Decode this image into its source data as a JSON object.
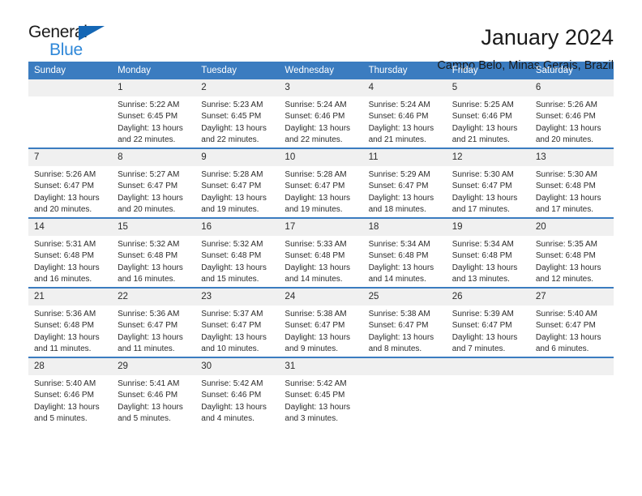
{
  "logo": {
    "word_one": "General",
    "word_two": "Blue",
    "triangle_color": "#1567b5",
    "blue_color": "#2e87d8"
  },
  "header": {
    "title": "January 2024",
    "subtitle": "Campo Belo, Minas Gerais, Brazil"
  },
  "theme": {
    "header_blue": "#3b7cc0",
    "daynum_band": "#f0f0f0",
    "text": "#2b2b2b"
  },
  "weekday_headers": [
    "Sunday",
    "Monday",
    "Tuesday",
    "Wednesday",
    "Thursday",
    "Friday",
    "Saturday"
  ],
  "weeks": [
    [
      {
        "day": "",
        "sunrise": "",
        "sunset": "",
        "daylight_line1": "",
        "daylight_line2": ""
      },
      {
        "day": "1",
        "sunrise": "Sunrise: 5:22 AM",
        "sunset": "Sunset: 6:45 PM",
        "daylight_line1": "Daylight: 13 hours",
        "daylight_line2": "and 22 minutes."
      },
      {
        "day": "2",
        "sunrise": "Sunrise: 5:23 AM",
        "sunset": "Sunset: 6:45 PM",
        "daylight_line1": "Daylight: 13 hours",
        "daylight_line2": "and 22 minutes."
      },
      {
        "day": "3",
        "sunrise": "Sunrise: 5:24 AM",
        "sunset": "Sunset: 6:46 PM",
        "daylight_line1": "Daylight: 13 hours",
        "daylight_line2": "and 22 minutes."
      },
      {
        "day": "4",
        "sunrise": "Sunrise: 5:24 AM",
        "sunset": "Sunset: 6:46 PM",
        "daylight_line1": "Daylight: 13 hours",
        "daylight_line2": "and 21 minutes."
      },
      {
        "day": "5",
        "sunrise": "Sunrise: 5:25 AM",
        "sunset": "Sunset: 6:46 PM",
        "daylight_line1": "Daylight: 13 hours",
        "daylight_line2": "and 21 minutes."
      },
      {
        "day": "6",
        "sunrise": "Sunrise: 5:26 AM",
        "sunset": "Sunset: 6:46 PM",
        "daylight_line1": "Daylight: 13 hours",
        "daylight_line2": "and 20 minutes."
      }
    ],
    [
      {
        "day": "7",
        "sunrise": "Sunrise: 5:26 AM",
        "sunset": "Sunset: 6:47 PM",
        "daylight_line1": "Daylight: 13 hours",
        "daylight_line2": "and 20 minutes."
      },
      {
        "day": "8",
        "sunrise": "Sunrise: 5:27 AM",
        "sunset": "Sunset: 6:47 PM",
        "daylight_line1": "Daylight: 13 hours",
        "daylight_line2": "and 20 minutes."
      },
      {
        "day": "9",
        "sunrise": "Sunrise: 5:28 AM",
        "sunset": "Sunset: 6:47 PM",
        "daylight_line1": "Daylight: 13 hours",
        "daylight_line2": "and 19 minutes."
      },
      {
        "day": "10",
        "sunrise": "Sunrise: 5:28 AM",
        "sunset": "Sunset: 6:47 PM",
        "daylight_line1": "Daylight: 13 hours",
        "daylight_line2": "and 19 minutes."
      },
      {
        "day": "11",
        "sunrise": "Sunrise: 5:29 AM",
        "sunset": "Sunset: 6:47 PM",
        "daylight_line1": "Daylight: 13 hours",
        "daylight_line2": "and 18 minutes."
      },
      {
        "day": "12",
        "sunrise": "Sunrise: 5:30 AM",
        "sunset": "Sunset: 6:47 PM",
        "daylight_line1": "Daylight: 13 hours",
        "daylight_line2": "and 17 minutes."
      },
      {
        "day": "13",
        "sunrise": "Sunrise: 5:30 AM",
        "sunset": "Sunset: 6:48 PM",
        "daylight_line1": "Daylight: 13 hours",
        "daylight_line2": "and 17 minutes."
      }
    ],
    [
      {
        "day": "14",
        "sunrise": "Sunrise: 5:31 AM",
        "sunset": "Sunset: 6:48 PM",
        "daylight_line1": "Daylight: 13 hours",
        "daylight_line2": "and 16 minutes."
      },
      {
        "day": "15",
        "sunrise": "Sunrise: 5:32 AM",
        "sunset": "Sunset: 6:48 PM",
        "daylight_line1": "Daylight: 13 hours",
        "daylight_line2": "and 16 minutes."
      },
      {
        "day": "16",
        "sunrise": "Sunrise: 5:32 AM",
        "sunset": "Sunset: 6:48 PM",
        "daylight_line1": "Daylight: 13 hours",
        "daylight_line2": "and 15 minutes."
      },
      {
        "day": "17",
        "sunrise": "Sunrise: 5:33 AM",
        "sunset": "Sunset: 6:48 PM",
        "daylight_line1": "Daylight: 13 hours",
        "daylight_line2": "and 14 minutes."
      },
      {
        "day": "18",
        "sunrise": "Sunrise: 5:34 AM",
        "sunset": "Sunset: 6:48 PM",
        "daylight_line1": "Daylight: 13 hours",
        "daylight_line2": "and 14 minutes."
      },
      {
        "day": "19",
        "sunrise": "Sunrise: 5:34 AM",
        "sunset": "Sunset: 6:48 PM",
        "daylight_line1": "Daylight: 13 hours",
        "daylight_line2": "and 13 minutes."
      },
      {
        "day": "20",
        "sunrise": "Sunrise: 5:35 AM",
        "sunset": "Sunset: 6:48 PM",
        "daylight_line1": "Daylight: 13 hours",
        "daylight_line2": "and 12 minutes."
      }
    ],
    [
      {
        "day": "21",
        "sunrise": "Sunrise: 5:36 AM",
        "sunset": "Sunset: 6:48 PM",
        "daylight_line1": "Daylight: 13 hours",
        "daylight_line2": "and 11 minutes."
      },
      {
        "day": "22",
        "sunrise": "Sunrise: 5:36 AM",
        "sunset": "Sunset: 6:47 PM",
        "daylight_line1": "Daylight: 13 hours",
        "daylight_line2": "and 11 minutes."
      },
      {
        "day": "23",
        "sunrise": "Sunrise: 5:37 AM",
        "sunset": "Sunset: 6:47 PM",
        "daylight_line1": "Daylight: 13 hours",
        "daylight_line2": "and 10 minutes."
      },
      {
        "day": "24",
        "sunrise": "Sunrise: 5:38 AM",
        "sunset": "Sunset: 6:47 PM",
        "daylight_line1": "Daylight: 13 hours",
        "daylight_line2": "and 9 minutes."
      },
      {
        "day": "25",
        "sunrise": "Sunrise: 5:38 AM",
        "sunset": "Sunset: 6:47 PM",
        "daylight_line1": "Daylight: 13 hours",
        "daylight_line2": "and 8 minutes."
      },
      {
        "day": "26",
        "sunrise": "Sunrise: 5:39 AM",
        "sunset": "Sunset: 6:47 PM",
        "daylight_line1": "Daylight: 13 hours",
        "daylight_line2": "and 7 minutes."
      },
      {
        "day": "27",
        "sunrise": "Sunrise: 5:40 AM",
        "sunset": "Sunset: 6:47 PM",
        "daylight_line1": "Daylight: 13 hours",
        "daylight_line2": "and 6 minutes."
      }
    ],
    [
      {
        "day": "28",
        "sunrise": "Sunrise: 5:40 AM",
        "sunset": "Sunset: 6:46 PM",
        "daylight_line1": "Daylight: 13 hours",
        "daylight_line2": "and 5 minutes."
      },
      {
        "day": "29",
        "sunrise": "Sunrise: 5:41 AM",
        "sunset": "Sunset: 6:46 PM",
        "daylight_line1": "Daylight: 13 hours",
        "daylight_line2": "and 5 minutes."
      },
      {
        "day": "30",
        "sunrise": "Sunrise: 5:42 AM",
        "sunset": "Sunset: 6:46 PM",
        "daylight_line1": "Daylight: 13 hours",
        "daylight_line2": "and 4 minutes."
      },
      {
        "day": "31",
        "sunrise": "Sunrise: 5:42 AM",
        "sunset": "Sunset: 6:45 PM",
        "daylight_line1": "Daylight: 13 hours",
        "daylight_line2": "and 3 minutes."
      },
      {
        "day": "",
        "sunrise": "",
        "sunset": "",
        "daylight_line1": "",
        "daylight_line2": ""
      },
      {
        "day": "",
        "sunrise": "",
        "sunset": "",
        "daylight_line1": "",
        "daylight_line2": ""
      },
      {
        "day": "",
        "sunrise": "",
        "sunset": "",
        "daylight_line1": "",
        "daylight_line2": ""
      }
    ]
  ]
}
